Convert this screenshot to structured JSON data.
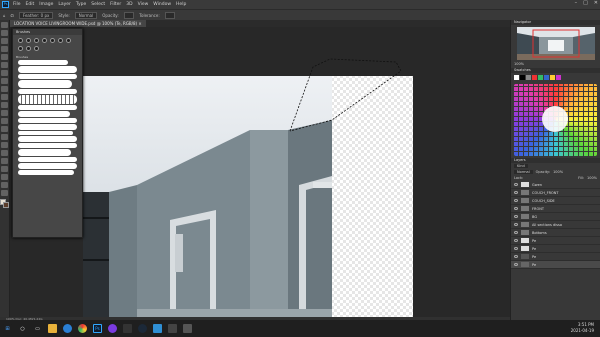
{
  "menubar": {
    "logo": "Ps",
    "items": [
      "File",
      "Edit",
      "Image",
      "Layer",
      "Type",
      "Select",
      "Filter",
      "3D",
      "View",
      "Window",
      "Help"
    ],
    "window_controls": [
      "–",
      "□",
      "✕"
    ]
  },
  "options": {
    "tool_preset": "Feather: 0 px",
    "style_label": "Style:",
    "style_value": "Normal",
    "opacity_label": "Opacity:",
    "tolerance_label": "Tolerance:"
  },
  "document": {
    "tab_title": "LOCATION VOICE LIVINGROOM WIDE.psd @ 100% (Te, RGB/8) ×"
  },
  "status": {
    "zoom_doc": "100%     Doc: 40.4M/1.22G"
  },
  "brushes_panel": {
    "title": "Brushes",
    "group_label": "Brushes"
  },
  "navigator": {
    "title": "Navigator",
    "zoom": "100%"
  },
  "swatches": {
    "title": "Swatches"
  },
  "layers": {
    "title": "Layers",
    "kind_label": "Kind",
    "blend_mode": "Normal",
    "opacity_label": "Opacity:",
    "opacity_value": "100%",
    "lock_label": "Lock:",
    "fill_label": "Fill:",
    "fill_value": "100%",
    "rows": [
      {
        "name": "Gwen"
      },
      {
        "name": "COUCH_FRONT"
      },
      {
        "name": "COUCH_SIDE"
      },
      {
        "name": "FRONT"
      },
      {
        "name": "BG"
      },
      {
        "name": "All sections disso"
      },
      {
        "name": "Bottoms"
      },
      {
        "name": "Pe"
      },
      {
        "name": "Pe"
      },
      {
        "name": "Pe"
      },
      {
        "name": "Pe"
      }
    ]
  },
  "taskbar": {
    "time": "3:51 PM",
    "date": "2021-04-19"
  },
  "colors": {
    "accent": "#31a8ff",
    "wall": "#8a969c",
    "ceiling": "#dde3e8"
  }
}
